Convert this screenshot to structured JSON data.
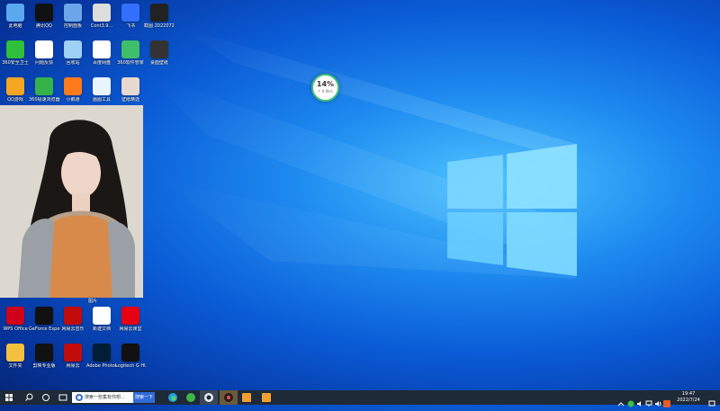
{
  "desktop": {
    "icons": [
      {
        "label": "此电脑",
        "name": "this-pc-icon",
        "color": "#5aa9f0"
      },
      {
        "label": "腾讯QQ",
        "name": "qq-icon",
        "color": "#111"
      },
      {
        "label": "控制面板",
        "name": "control-panel-icon",
        "color": "#6aa6e8"
      },
      {
        "label": "Cont3.9...",
        "name": "image-file-icon",
        "color": "#ddd"
      },
      {
        "label": "飞书",
        "name": "feishu-icon",
        "color": "#3370ff"
      },
      {
        "label": "截图 20220724...",
        "name": "screenshot-file-icon",
        "color": "#222"
      },
      {
        "label": "360安全卫士",
        "name": "360-security-icon",
        "color": "#2fbf3b"
      },
      {
        "label": "问题反馈",
        "name": "feedback-icon",
        "color": "#ffffff"
      },
      {
        "label": "回收站",
        "name": "recycle-bin-icon",
        "color": "#9fd0f5"
      },
      {
        "label": "百度网盘",
        "name": "baidu-netdisk-icon",
        "color": "#ffffff"
      },
      {
        "label": "360软件管家",
        "name": "360-software-icon",
        "color": "#3fbf6a"
      },
      {
        "label": "桌面壁纸",
        "name": "wallpaper-icon",
        "color": "#333"
      },
      {
        "label": "QQ游戏",
        "name": "qq-game-icon",
        "color": "#f5a623"
      },
      {
        "label": "360极速浏览器",
        "name": "360-browser-icon",
        "color": "#35b34a"
      },
      {
        "label": "小鹅通",
        "name": "xiaoetong-icon",
        "color": "#ff7a1a"
      },
      {
        "label": "画图工具",
        "name": "paint-icon",
        "color": "#e8f4ff"
      },
      {
        "label": "壁纸精选",
        "name": "photo-file-icon",
        "color": "#e8d8d0"
      },
      {
        "label": "WPS Office",
        "name": "wps-icon",
        "color": "#d0021b"
      },
      {
        "label": "GeForce Experience",
        "name": "geforce-icon",
        "color": "#111"
      },
      {
        "label": "网易云音乐",
        "name": "netease-music-icon",
        "color": "#c20c0c"
      },
      {
        "label": "新建文档",
        "name": "document-file-icon",
        "color": "#ffffff"
      },
      {
        "label": "网易云课堂",
        "name": "netease-class-icon",
        "color": "#e60012"
      },
      {
        "label": "文件夹",
        "name": "folder-icon",
        "color": "#f3c040"
      },
      {
        "label": "剪映专业版",
        "name": "jianying-icon",
        "color": "#111"
      },
      {
        "label": "网易云",
        "name": "netease-cloud-icon",
        "color": "#c20c0c"
      },
      {
        "label": "Adobe Photoshop",
        "name": "photoshop-icon",
        "color": "#001e36"
      },
      {
        "label": "Logitech G HUB",
        "name": "logitech-icon",
        "color": "#111"
      }
    ],
    "photo_caption": "图片",
    "speed_ball": {
      "percent": "14%",
      "speed": "↑ 0.0k/s"
    }
  },
  "taskbar": {
    "search_text": "搜索一些集有你想...",
    "search_button": "搜索一下",
    "clock_time": "19:47",
    "clock_date": "2022/7/24"
  },
  "colors": {
    "taskbar": "#1f2a38",
    "accent": "#2f6ad9"
  }
}
